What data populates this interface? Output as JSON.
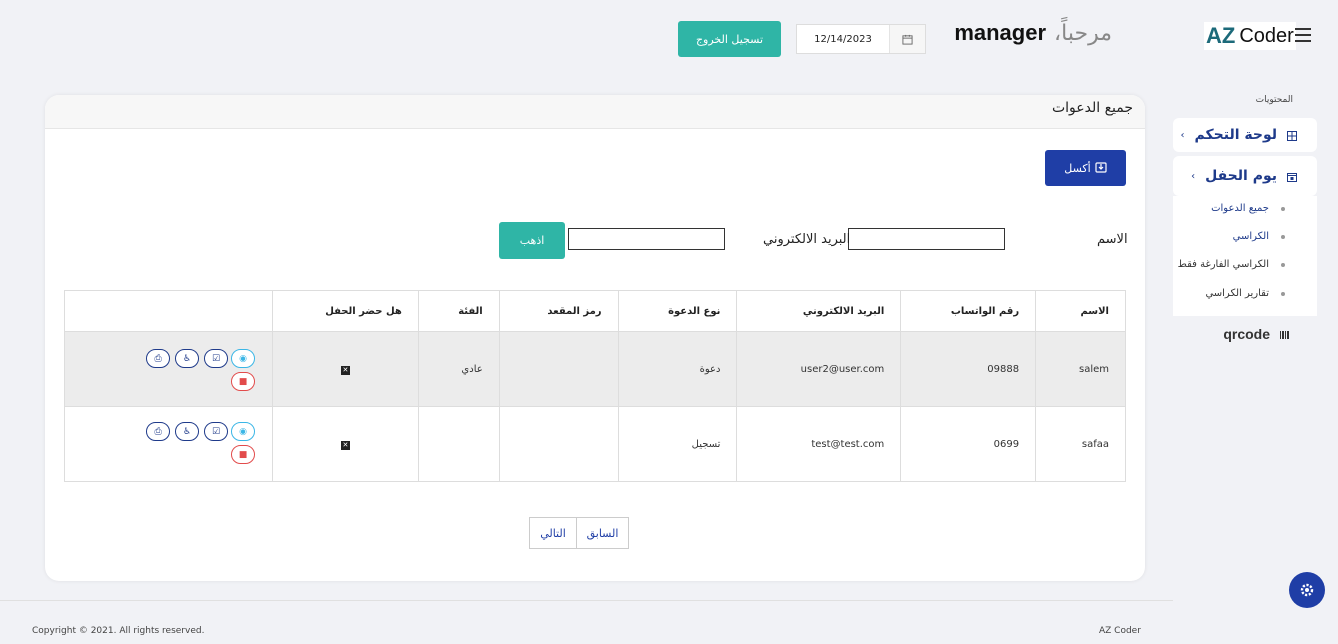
{
  "header": {
    "brand_az": "AZ",
    "brand_coder": "Coder",
    "greeting": "مرحباً،",
    "username": "manager",
    "date": "12/14/2023",
    "logout_label": "تسجيل الخروج"
  },
  "sidebar": {
    "heading": "المحتويات",
    "dashboard_label": "لوحة التحكم",
    "party_day_label": "يوم الحفل",
    "sub_items": [
      "جميع الدعوات",
      "الكراسي",
      "الكراسي الفارغة فقط",
      "تقارير الكراسي"
    ],
    "qrcode_label": "qrcode"
  },
  "main": {
    "title": "جميع الدعوات",
    "excel_label": "أكسل",
    "filter": {
      "name_label": "الاسم",
      "email_label": "البريد الالكتروني",
      "go_label": "اذهب"
    },
    "table": {
      "headers": [
        "الاسم",
        "رقم الواتساب",
        "البريد الالكتروني",
        "نوع الدعوة",
        "رمز المقعد",
        "الفئة",
        "هل حضر الحفل",
        ""
      ],
      "rows": [
        {
          "name": "salem",
          "whatsapp": "09888",
          "email": "user2@user.com",
          "type": "دعوة",
          "seat": "",
          "category": "عادي",
          "attended": "✕"
        },
        {
          "name": "safaa",
          "whatsapp": "0699",
          "email": "test@test.com",
          "type": "تسجيل",
          "seat": "",
          "category": "",
          "attended": "✕"
        }
      ]
    },
    "pager": {
      "prev_label": "السابق",
      "next_label": "التالي"
    }
  },
  "footer": {
    "copyright": "Copyright © 2021. All rights reserved.",
    "brand": "AZ Coder"
  },
  "colors": {
    "teal": "#2fb5a6",
    "navy": "#1f3ea6",
    "view": "#3ab6e6",
    "delete": "#e24b4b"
  },
  "icons": [
    "menu-icon",
    "calendar-icon",
    "grid-icon",
    "calendar-check-icon",
    "barcode-icon",
    "excel-icon",
    "eye-icon",
    "edit-icon",
    "seat-icon",
    "print-icon",
    "trash-icon",
    "gear-icon"
  ]
}
